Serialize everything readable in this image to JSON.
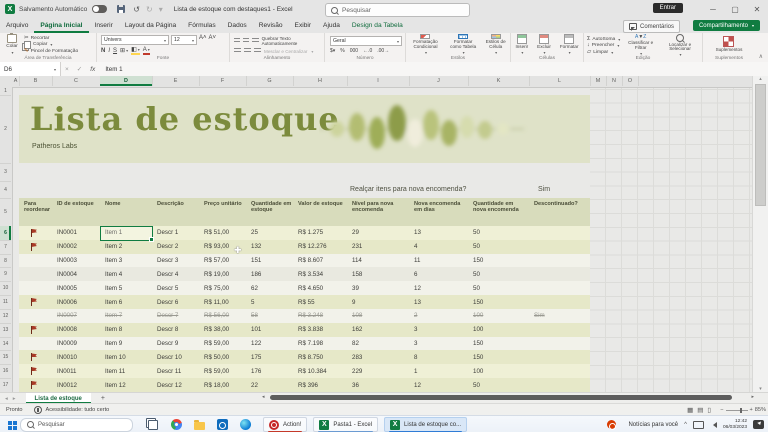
{
  "titlebar": {
    "autosave_label": "Salvamento Automático",
    "doc_title": "Lista de estoque com destaques1 - Excel",
    "search_placeholder": "Pesquisar",
    "sign_in": "Entrar"
  },
  "menubar": {
    "tabs": [
      "Arquivo",
      "Página Inicial",
      "Inserir",
      "Layout da Página",
      "Fórmulas",
      "Dados",
      "Revisão",
      "Exibir",
      "Ajuda",
      "Design da Tabela"
    ],
    "active_tab": "Página Inicial",
    "contextual_tab": "Design da Tabela",
    "comments_label": "Comentários",
    "share_label": "Compartilhamento"
  },
  "ribbon": {
    "clipboard": {
      "group": "Área de Transferência",
      "paste": "Colar",
      "cut": "Recortar",
      "copy": "Copiar",
      "painter": "Pincel de Formatação"
    },
    "font": {
      "group": "Fonte",
      "family": "Univers",
      "size": "12",
      "bold": "N",
      "italic": "I",
      "underline": "S"
    },
    "alignment": {
      "group": "Alinhamento",
      "wrap": "Quebrar Texto Automaticamente",
      "merge": "Mesclar e Centralizar"
    },
    "number": {
      "group": "Número",
      "format": "Geral"
    },
    "styles": {
      "group": "Estilos",
      "conditional": "Formatação Condicional",
      "format_table": "Formatar como Tabela",
      "cell_styles": "Estilos de Célula"
    },
    "cells": {
      "group": "Células",
      "insert": "Inserir",
      "delete": "Excluir",
      "format": "Formatar"
    },
    "editing": {
      "group": "Edição",
      "autosum": "AutoSoma",
      "fill": "Preencher",
      "clear": "Limpar",
      "sort": "Classificar e Filtrar",
      "find": "Localizar e Selecionar"
    },
    "addins": {
      "group": "Suplementos",
      "button": "Suplementos"
    }
  },
  "formula_bar": {
    "cell_ref": "D6",
    "fx": "fx",
    "value": "Item 1"
  },
  "sheet": {
    "column_letters": [
      "A",
      "B",
      "C",
      "D",
      "E",
      "F",
      "G",
      "H",
      "I",
      "J",
      "K",
      "L",
      "M",
      "N",
      "O"
    ],
    "selected_column": "D",
    "row_numbers": [
      1,
      2,
      3,
      4,
      5,
      6,
      7,
      8,
      9,
      10,
      11,
      12,
      13,
      14,
      15,
      16,
      17
    ],
    "selected_row": 6,
    "banner": {
      "title": "Lista de estoque",
      "subtitle": "Patheros Labs"
    },
    "prompt": {
      "question": "Realçar itens para nova encomenda?",
      "answer": "Sim"
    },
    "table": {
      "headers": [
        "Para reordenar",
        "ID de estoque",
        "Nome",
        "Descrição",
        "Preço unitário",
        "Quantidade em estoque",
        "Valor de estoque",
        "Nível para nova encomenda",
        "Nova encomenda em dias",
        "Quantidade em nova encomenda",
        "Descontinuado?"
      ],
      "rows": [
        {
          "flag": true,
          "strike": false,
          "id": "IN0001",
          "name": "Item 1",
          "desc": "Descr 1",
          "price": "R$ 51,00",
          "qty": "25",
          "value": "R$ 1.275",
          "level": "29",
          "days": "13",
          "reorder_qty": "50",
          "discontinued": ""
        },
        {
          "flag": true,
          "strike": false,
          "id": "IN0002",
          "name": "Item 2",
          "desc": "Descr 2",
          "price": "R$ 93,00",
          "qty": "132",
          "value": "R$ 12.276",
          "level": "231",
          "days": "4",
          "reorder_qty": "50",
          "discontinued": ""
        },
        {
          "flag": false,
          "strike": false,
          "id": "IN0003",
          "name": "Item 3",
          "desc": "Descr 3",
          "price": "R$ 57,00",
          "qty": "151",
          "value": "R$ 8.607",
          "level": "114",
          "days": "11",
          "reorder_qty": "150",
          "discontinued": ""
        },
        {
          "flag": false,
          "strike": false,
          "id": "IN0004",
          "name": "Item 4",
          "desc": "Descr 4",
          "price": "R$ 19,00",
          "qty": "186",
          "value": "R$ 3.534",
          "level": "158",
          "days": "6",
          "reorder_qty": "50",
          "discontinued": ""
        },
        {
          "flag": false,
          "strike": false,
          "id": "IN0005",
          "name": "Item 5",
          "desc": "Descr 5",
          "price": "R$ 75,00",
          "qty": "62",
          "value": "R$ 4.650",
          "level": "39",
          "days": "12",
          "reorder_qty": "50",
          "discontinued": ""
        },
        {
          "flag": true,
          "strike": false,
          "id": "IN0006",
          "name": "Item 6",
          "desc": "Descr 6",
          "price": "R$ 11,00",
          "qty": "5",
          "value": "R$ 55",
          "level": "9",
          "days": "13",
          "reorder_qty": "150",
          "discontinued": ""
        },
        {
          "flag": false,
          "strike": true,
          "id": "IN0007",
          "name": "Item 7",
          "desc": "Descr 7",
          "price": "R$ 56,00",
          "qty": "58",
          "value": "R$ 3.248",
          "level": "108",
          "days": "2",
          "reorder_qty": "100",
          "discontinued": "Sim"
        },
        {
          "flag": true,
          "strike": false,
          "id": "IN0008",
          "name": "Item 8",
          "desc": "Descr 8",
          "price": "R$ 38,00",
          "qty": "101",
          "value": "R$ 3.838",
          "level": "162",
          "days": "3",
          "reorder_qty": "100",
          "discontinued": ""
        },
        {
          "flag": false,
          "strike": false,
          "id": "IN0009",
          "name": "Item 9",
          "desc": "Descr 9",
          "price": "R$ 59,00",
          "qty": "122",
          "value": "R$ 7.198",
          "level": "82",
          "days": "3",
          "reorder_qty": "150",
          "discontinued": ""
        },
        {
          "flag": true,
          "strike": false,
          "id": "IN0010",
          "name": "Item 10",
          "desc": "Descr 10",
          "price": "R$ 50,00",
          "qty": "175",
          "value": "R$ 8.750",
          "level": "283",
          "days": "8",
          "reorder_qty": "150",
          "discontinued": ""
        },
        {
          "flag": true,
          "strike": false,
          "id": "IN0011",
          "name": "Item 11",
          "desc": "Descr 11",
          "price": "R$ 59,00",
          "qty": "176",
          "value": "R$ 10.384",
          "level": "229",
          "days": "1",
          "reorder_qty": "100",
          "discontinued": ""
        },
        {
          "flag": true,
          "strike": false,
          "id": "IN0012",
          "name": "Item 12",
          "desc": "Descr 12",
          "price": "R$ 18,00",
          "qty": "22",
          "value": "R$ 396",
          "level": "36",
          "days": "12",
          "reorder_qty": "50",
          "discontinued": ""
        }
      ]
    }
  },
  "sheet_tabs": {
    "active_tab": "Lista de estoque",
    "add_label": "+"
  },
  "status_bar": {
    "mode": "Pronto",
    "accessibility": "Acessibilidade: tudo certo",
    "zoom": "85%"
  },
  "taskbar": {
    "search_placeholder": "Pesquisar",
    "app_icons": [
      "task-view",
      "chrome",
      "file-explorer",
      "outlook",
      "edge"
    ],
    "window_buttons": [
      {
        "label": "Action!",
        "icon": "action",
        "indicator": "#c53929"
      },
      {
        "label": "Pasta1 - Excel",
        "icon": "excel",
        "indicator": "#6b9bd2"
      },
      {
        "label": "Lista de estoque co...",
        "icon": "excel",
        "indicator": "#2f7cd6",
        "active": true
      }
    ],
    "news": "Notícias para você",
    "time": "12:42",
    "date": "06/03/2023"
  },
  "colors": {
    "excel_green": "#107c41",
    "banner_sage": "#dfe2c8",
    "title_olive": "#7c8b3d",
    "flag_red": "#a93a26",
    "highlight_row_light": "#eff0d6",
    "highlight_row_dark": "#e6e8c8",
    "plain_row_light": "#f2f2ea",
    "plain_row_dark": "#e9e9e0",
    "taskbar_bg": "#eef2f8"
  }
}
